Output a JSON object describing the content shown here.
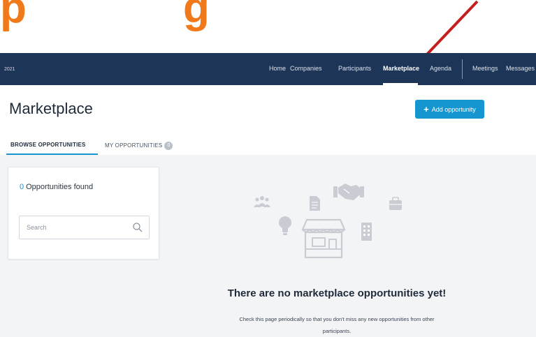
{
  "headline": {
    "part1": "p",
    "part2": "g"
  },
  "nav": {
    "year": "2021",
    "items": [
      {
        "label": "Home"
      },
      {
        "label": "Companies"
      },
      {
        "label": "Participants"
      },
      {
        "label": "Marketplace"
      },
      {
        "label": "Agenda"
      },
      {
        "label": "Meetings"
      },
      {
        "label": "Messages"
      }
    ]
  },
  "page": {
    "title": "Marketplace"
  },
  "toolbar": {
    "add_label": "Add opportunity",
    "add_icon": "plus-icon"
  },
  "tabs": {
    "browse": "BROWSE OPPORTUNITIES",
    "mine": "MY OPPORTUNITIES",
    "mine_count": "0"
  },
  "results": {
    "count": "0",
    "label": "Opportunities found"
  },
  "search": {
    "placeholder": "Search"
  },
  "empty": {
    "title": "There are no marketplace opportunities yet!",
    "line1": "Check this page periodically so that you don't miss any new opportunities from other",
    "line2": "participants."
  },
  "colors": {
    "headline": "#f07a1a",
    "arrow": "#c41e1e",
    "navbar": "#1d3557",
    "accent": "#1596d1",
    "content_bg": "#f3f4f6",
    "illustration": "#c9cdd3"
  }
}
